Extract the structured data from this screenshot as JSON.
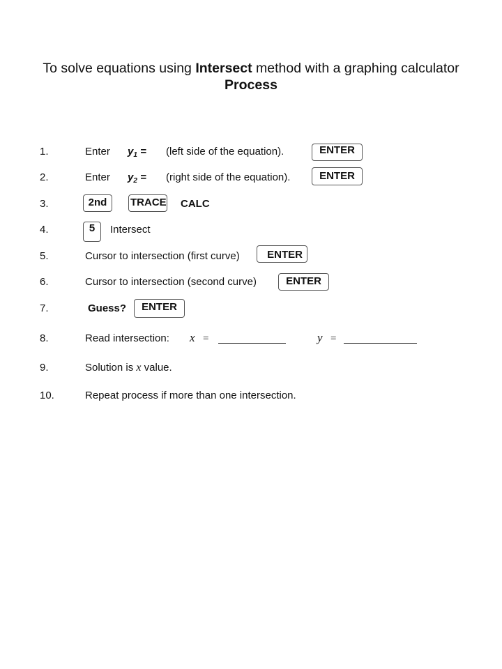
{
  "header": {
    "title_prefix": "To solve equations using ",
    "title_bold": "Intersect",
    "title_suffix": " method with a graphing calculator",
    "subtitle": "Process"
  },
  "steps": [
    {
      "num": "1.",
      "verb": "Enter",
      "var": "y",
      "sub": "1",
      "eq": " =",
      "desc": "(left side of the equation).",
      "key": "ENTER"
    },
    {
      "num": "2.",
      "verb": "Enter",
      "var": "y",
      "sub": "2",
      "eq": " =",
      "desc": "(right side of the equation).",
      "key": "ENTER"
    },
    {
      "num": "3.",
      "key1": "2nd",
      "key2": "TRACE",
      "label": "CALC"
    },
    {
      "num": "4.",
      "key": "5",
      "label": "Intersect"
    },
    {
      "num": "5.",
      "text": "Cursor to intersection (first curve)",
      "key": "ENTER"
    },
    {
      "num": "6.",
      "text": "Cursor to intersection (second  curve)",
      "key": "ENTER"
    },
    {
      "num": "7.",
      "label": "Guess?",
      "key": "ENTER"
    },
    {
      "num": "8.",
      "text": "Read intersection:",
      "x_var": "x",
      "y_var": "y",
      "eq": "=",
      "x_value": "",
      "y_value": ""
    },
    {
      "num": "9.",
      "text_before": "Solution is ",
      "var": "x",
      "text_after": " value."
    },
    {
      "num": "10.",
      "text": "Repeat process if more than one intersection."
    }
  ]
}
